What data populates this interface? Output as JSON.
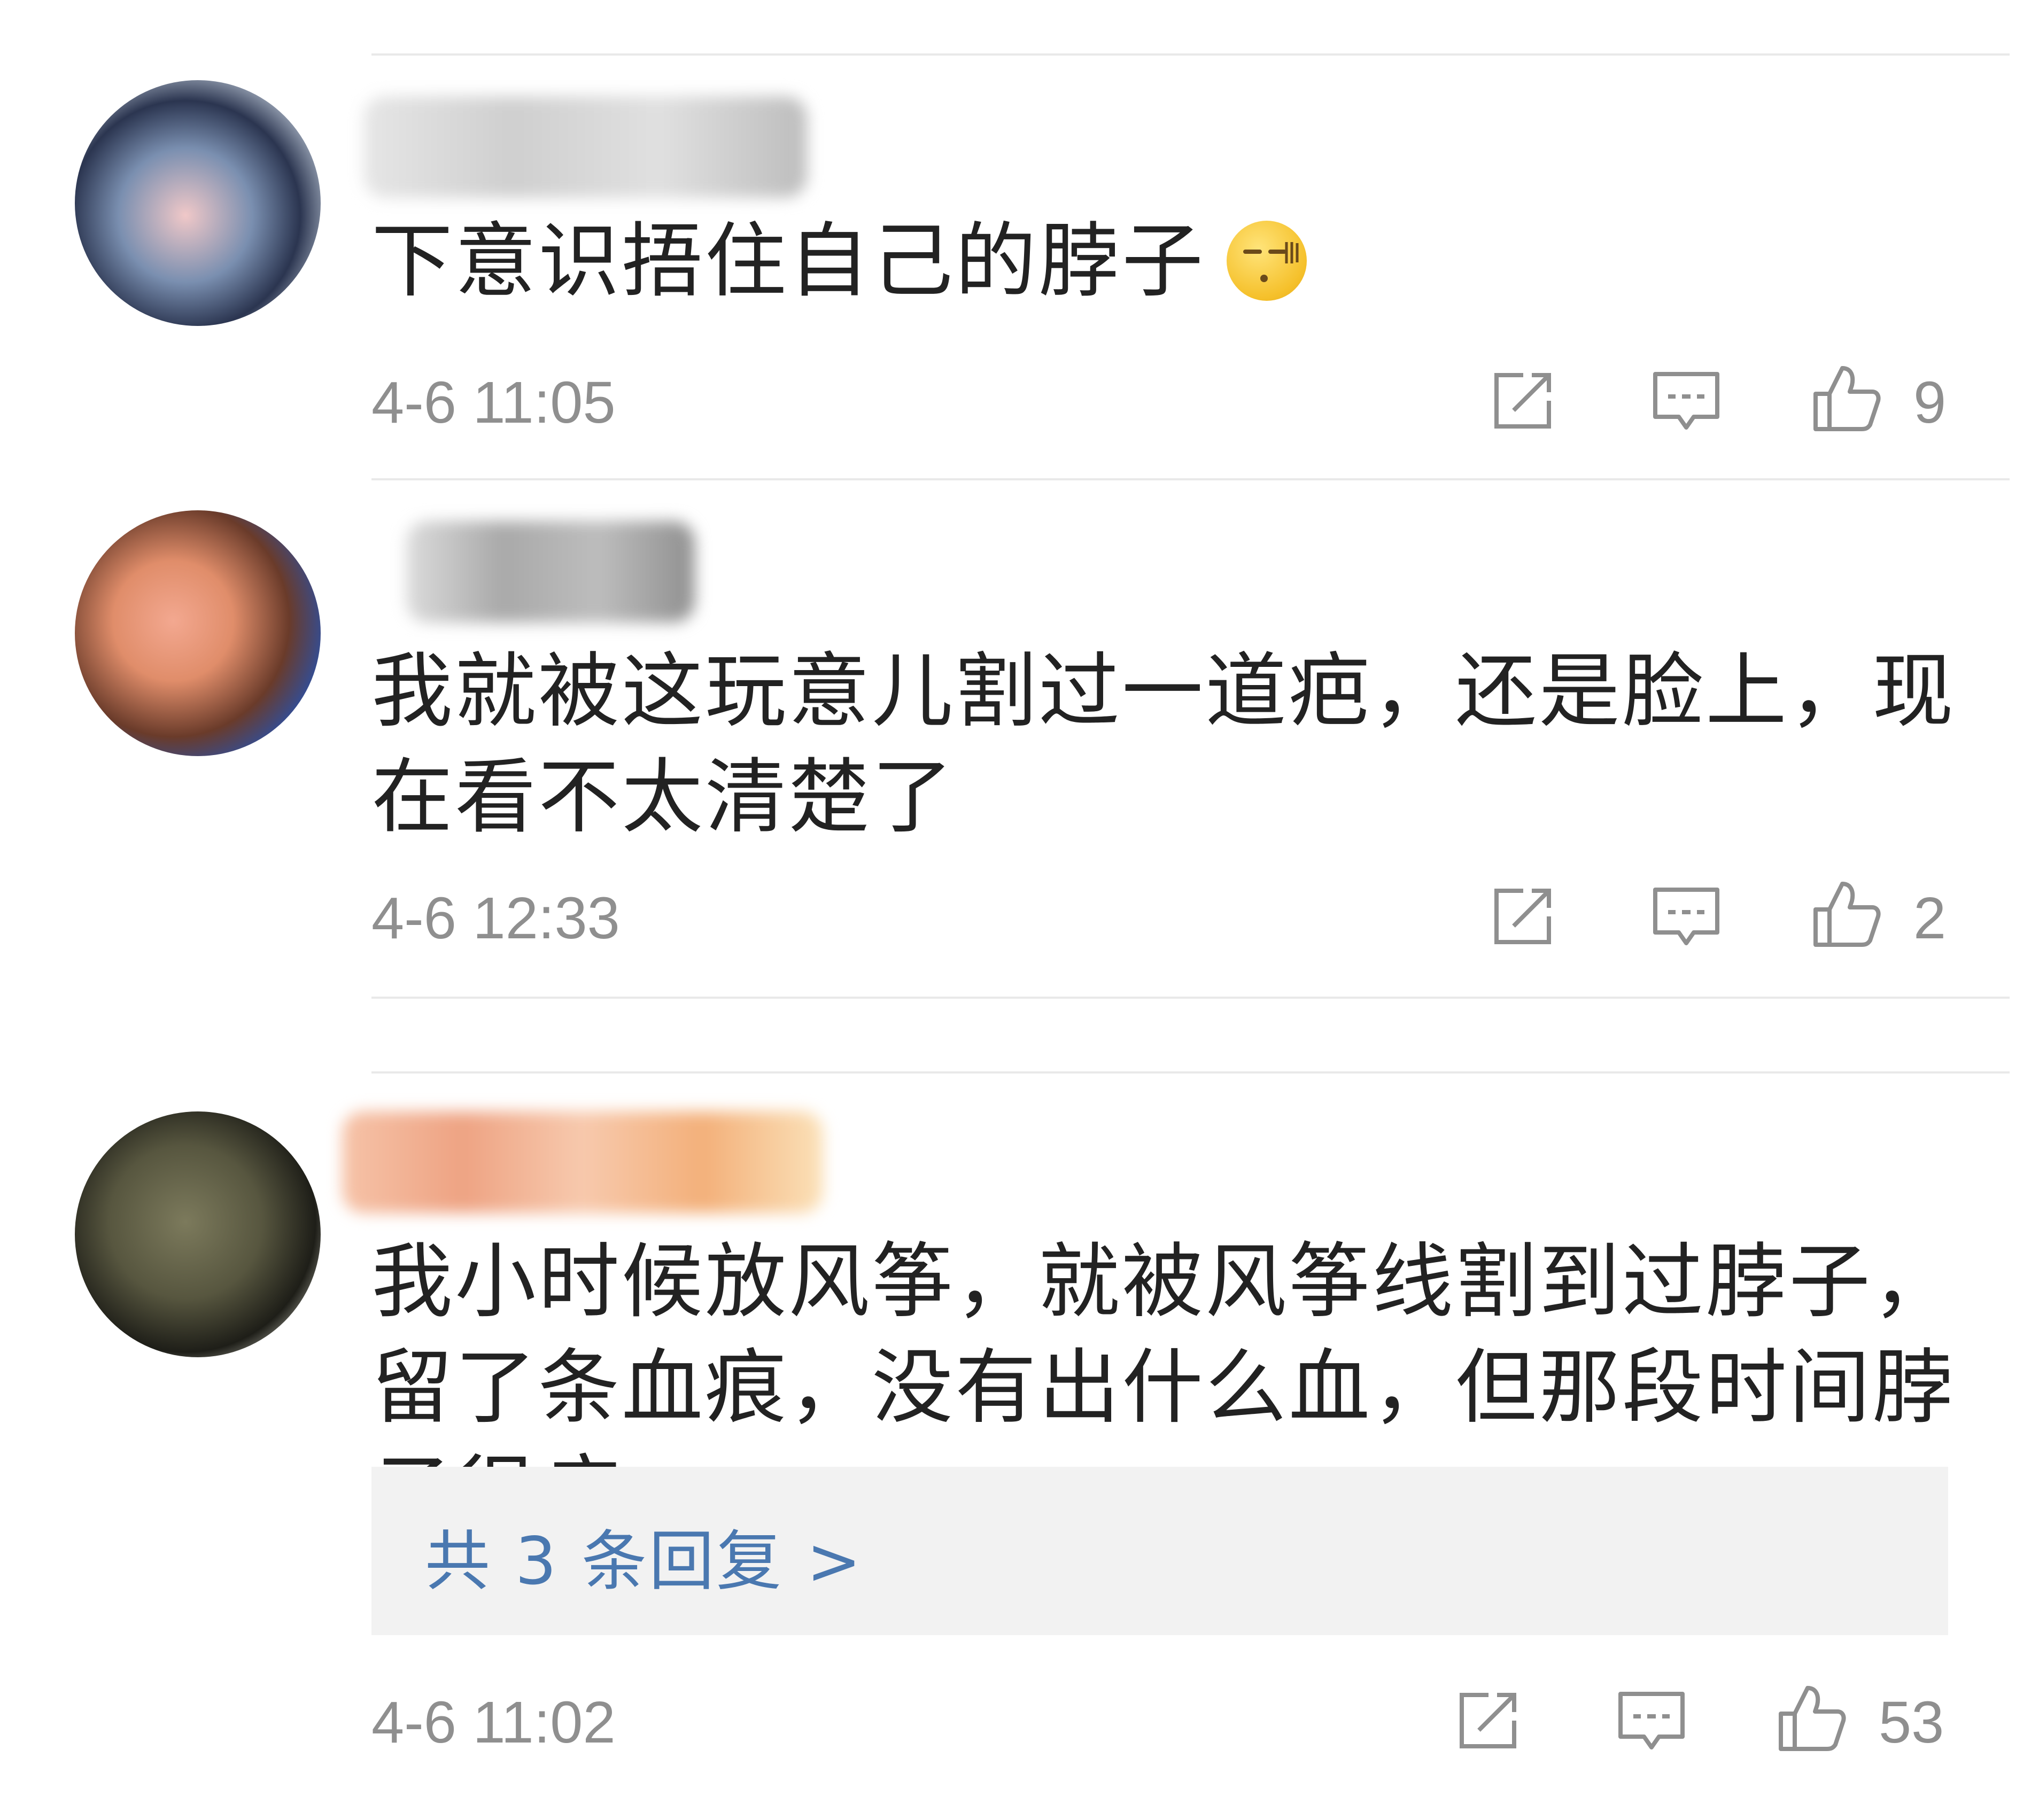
{
  "comments": [
    {
      "text": "下意识捂住自己的脖子",
      "emoji": "smirk-emoji",
      "time": "4-6 11:05",
      "likes": "9"
    },
    {
      "text": "我就被这玩意儿割过一道疤，还是脸上，现在看不太清楚了",
      "time": "4-6 12:33",
      "likes": "2"
    },
    {
      "text": "我小时候放风筝，就被风筝线割到过脖子，留了条血痕，没有出什么血，但那段时间脖子很疼",
      "reply_summary": "共 3 条回复 >",
      "time": "4-6 11:02",
      "likes": "53"
    }
  ],
  "icons": {
    "share": "share-icon",
    "comment": "comment-icon",
    "like": "thumbs-up-icon"
  },
  "colors": {
    "text": "#222222",
    "meta": "#8f8f8f",
    "link": "#4a78b0",
    "reply_bg": "#f2f2f2",
    "divider": "#e9e9e9"
  }
}
